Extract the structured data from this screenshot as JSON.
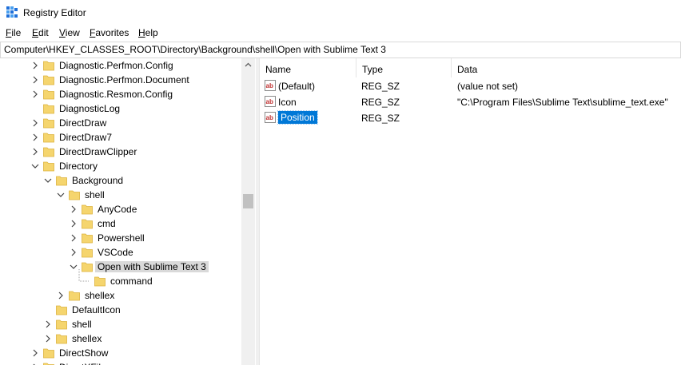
{
  "window": {
    "title": "Registry Editor"
  },
  "menu": [
    {
      "accel": "F",
      "rest": "ile"
    },
    {
      "accel": "E",
      "rest": "dit"
    },
    {
      "accel": "V",
      "rest": "iew"
    },
    {
      "accel": "F",
      "rest": "avorites"
    },
    {
      "accel": "H",
      "rest": "elp"
    }
  ],
  "address": "Computer\\HKEY_CLASSES_ROOT\\Directory\\Background\\shell\\Open with Sublime Text 3",
  "tree": [
    {
      "label": "Diagnostic.Perfmon.Config",
      "level": 0,
      "chevron": "right"
    },
    {
      "label": "Diagnostic.Perfmon.Document",
      "level": 0,
      "chevron": "right"
    },
    {
      "label": "Diagnostic.Resmon.Config",
      "level": 0,
      "chevron": "right"
    },
    {
      "label": "DiagnosticLog",
      "level": 0,
      "chevron": "none"
    },
    {
      "label": "DirectDraw",
      "level": 0,
      "chevron": "right"
    },
    {
      "label": "DirectDraw7",
      "level": 0,
      "chevron": "right"
    },
    {
      "label": "DirectDrawClipper",
      "level": 0,
      "chevron": "right"
    },
    {
      "label": "Directory",
      "level": 0,
      "chevron": "down"
    },
    {
      "label": "Background",
      "level": 1,
      "chevron": "down"
    },
    {
      "label": "shell",
      "level": 2,
      "chevron": "down"
    },
    {
      "label": "AnyCode",
      "level": 3,
      "chevron": "right"
    },
    {
      "label": "cmd",
      "level": 3,
      "chevron": "right"
    },
    {
      "label": "Powershell",
      "level": 3,
      "chevron": "right"
    },
    {
      "label": "VSCode",
      "level": 3,
      "chevron": "right"
    },
    {
      "label": "Open with Sublime Text 3",
      "level": 3,
      "chevron": "down",
      "selected": true
    },
    {
      "label": "command",
      "level": 4,
      "chevron": "none"
    },
    {
      "label": "shellex",
      "level": 2,
      "chevron": "right"
    },
    {
      "label": "DefaultIcon",
      "level": 1,
      "chevron": "none"
    },
    {
      "label": "shell",
      "level": 1,
      "chevron": "right"
    },
    {
      "label": "shellex",
      "level": 1,
      "chevron": "right"
    },
    {
      "label": "DirectShow",
      "level": 0,
      "chevron": "right"
    },
    {
      "label": "DirectXFile",
      "level": 0,
      "chevron": "right"
    }
  ],
  "columns": {
    "name": "Name",
    "type": "Type",
    "data": "Data"
  },
  "values": [
    {
      "name": "(Default)",
      "type": "REG_SZ",
      "data": "(value not set)",
      "selected": false
    },
    {
      "name": "Icon",
      "type": "REG_SZ",
      "data": "\"C:\\Program Files\\Sublime Text\\sublime_text.exe\"",
      "selected": false
    },
    {
      "name": "Position",
      "type": "REG_SZ",
      "data": "",
      "selected": true
    }
  ],
  "colors": {
    "selection": "#0078d7",
    "tree_selection": "#d9d9d9",
    "folder": "#f5d56e",
    "folder_edge": "#dcb23c"
  }
}
